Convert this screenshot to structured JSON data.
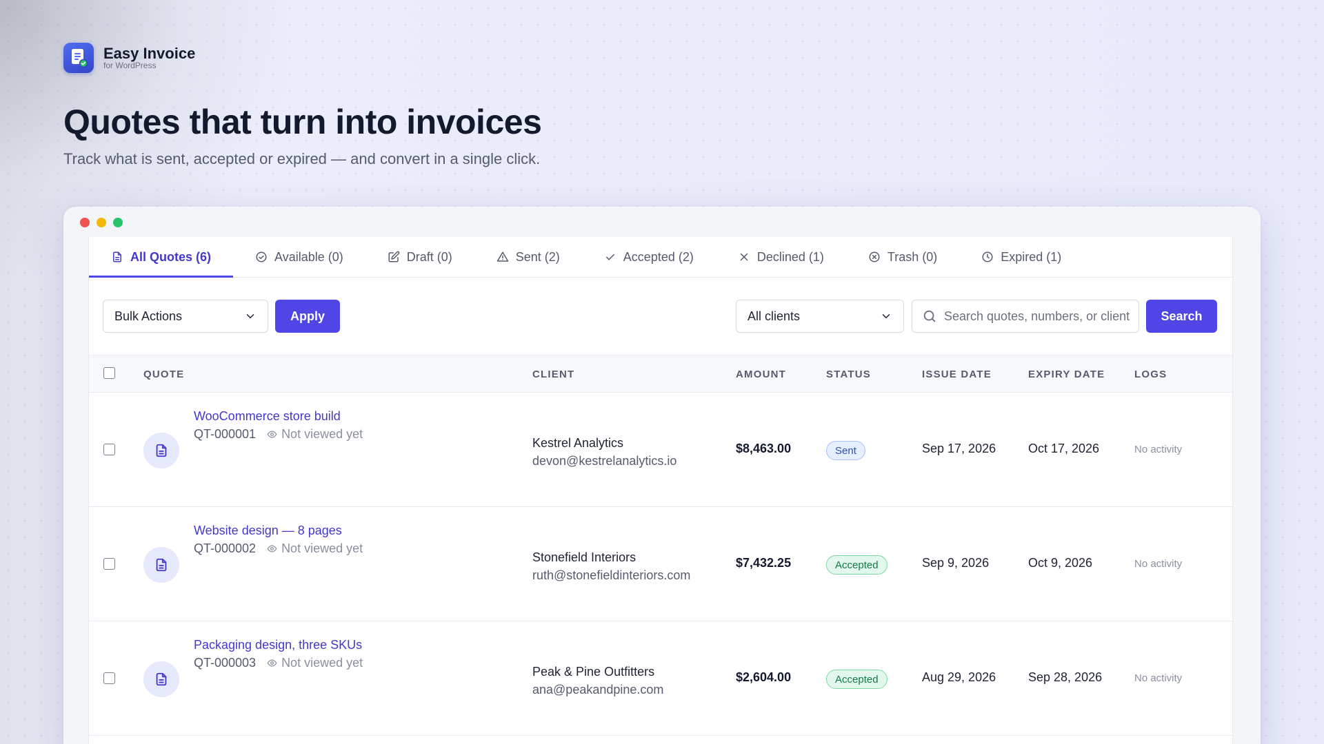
{
  "brand": {
    "name": "Easy Invoice",
    "subtitle": "for WordPress",
    "accent": "#4f46e5"
  },
  "hero": {
    "title": "Quotes that turn into invoices",
    "subtitle": "Track what is sent, accepted or expired — and convert in a single click."
  },
  "tabs": [
    {
      "label": "All Quotes (6)",
      "icon": "document-icon",
      "active": true
    },
    {
      "label": "Available (0)",
      "icon": "check-circle-icon"
    },
    {
      "label": "Draft (0)",
      "icon": "edit-icon"
    },
    {
      "label": "Sent (2)",
      "icon": "warning-icon"
    },
    {
      "label": "Accepted (2)",
      "icon": "check-icon"
    },
    {
      "label": "Declined (1)",
      "icon": "x-icon"
    },
    {
      "label": "Trash (0)",
      "icon": "x-circle-icon"
    },
    {
      "label": "Expired (1)",
      "icon": "clock-icon"
    }
  ],
  "toolbar": {
    "bulk_actions": "Bulk Actions",
    "apply": "Apply",
    "client_filter": "All clients",
    "search_placeholder": "Search quotes, numbers, or clients",
    "search_button": "Search"
  },
  "table": {
    "headers": {
      "quote": "QUOTE",
      "client": "CLIENT",
      "amount": "AMOUNT",
      "status": "STATUS",
      "issue_date": "ISSUE DATE",
      "expiry_date": "EXPIRY DATE",
      "logs": "LOGS"
    },
    "rows": [
      {
        "title": "WooCommerce store build",
        "number": "QT-000001",
        "viewed": "Not viewed yet",
        "client_name": "Kestrel Analytics",
        "client_email": "devon@kestrelanalytics.io",
        "amount": "$8,463.00",
        "status": "Sent",
        "issue_date": "Sep 17, 2026",
        "expiry_date": "Oct 17, 2026",
        "logs": "No activity"
      },
      {
        "title": "Website design — 8 pages",
        "number": "QT-000002",
        "viewed": "Not viewed yet",
        "client_name": "Stonefield Interiors",
        "client_email": "ruth@stonefieldinteriors.com",
        "amount": "$7,432.25",
        "status": "Accepted",
        "issue_date": "Sep 9, 2026",
        "expiry_date": "Oct 9, 2026",
        "logs": "No activity"
      },
      {
        "title": "Packaging design, three SKUs",
        "number": "QT-000003",
        "viewed": "Not viewed yet",
        "client_name": "Peak & Pine Outfitters",
        "client_email": "ana@peakandpine.com",
        "amount": "$2,604.00",
        "status": "Accepted",
        "issue_date": "Aug 29, 2026",
        "expiry_date": "Sep 28, 2026",
        "logs": "No activity"
      }
    ]
  }
}
